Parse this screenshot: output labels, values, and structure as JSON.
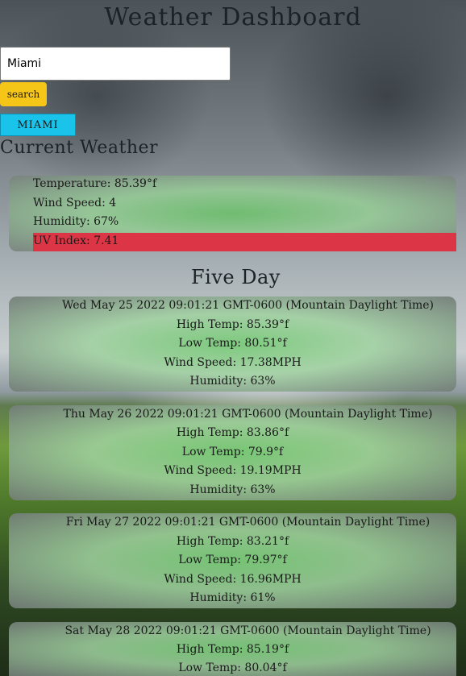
{
  "header": {
    "title": "Weather Dashboard"
  },
  "search": {
    "value": "Miami",
    "button_label": "search"
  },
  "history": {
    "items": [
      "MIAMI"
    ]
  },
  "current": {
    "section_title": "Current Weather",
    "temperature": "Temperature: 85.39°f",
    "wind": "Wind Speed: 4",
    "humidity": "Humidity: 67%",
    "uv": "UV Index: 7.41",
    "uv_color": "#dc3545"
  },
  "forecast": {
    "section_title": "Five Day",
    "days": [
      {
        "date": "Wed May 25 2022 09:01:21 GMT-0600 (Mountain Daylight Time)",
        "high": "High Temp: 85.39°f",
        "low": "Low Temp: 80.51°f",
        "wind": "Wind Speed: 17.38MPH",
        "humidity": "Humidity: 63%"
      },
      {
        "date": "Thu May 26 2022 09:01:21 GMT-0600 (Mountain Daylight Time)",
        "high": "High Temp: 83.86°f",
        "low": "Low Temp: 79.9°f",
        "wind": "Wind Speed: 19.19MPH",
        "humidity": "Humidity: 63%"
      },
      {
        "date": "Fri May 27 2022 09:01:21 GMT-0600 (Mountain Daylight Time)",
        "high": "High Temp: 83.21°f",
        "low": "Low Temp: 79.97°f",
        "wind": "Wind Speed: 16.96MPH",
        "humidity": "Humidity: 61%"
      },
      {
        "date": "Sat May 28 2022 09:01:21 GMT-0600 (Mountain Daylight Time)",
        "high": "High Temp: 85.19°f",
        "low": "Low Temp: 80.04°f"
      }
    ]
  },
  "colors": {
    "search_button": "#f5c518",
    "history_button": "#19c3ea",
    "uv_high": "#dc3545"
  }
}
